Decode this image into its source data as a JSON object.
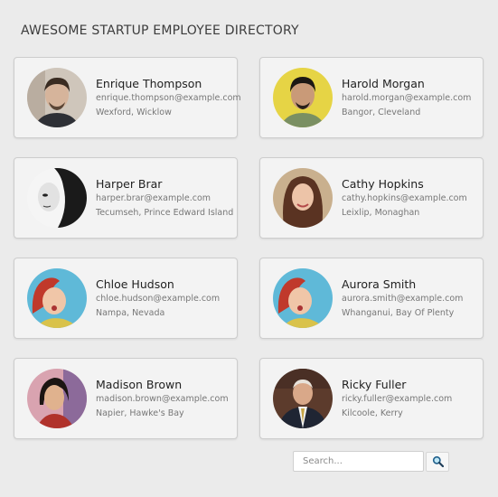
{
  "header": {
    "title": "AWESOME STARTUP EMPLOYEE DIRECTORY"
  },
  "employees": [
    {
      "name": "Enrique Thompson",
      "email": "enrique.thompson@example.com",
      "location": "Wexford, Wicklow",
      "avatar": "avatar-photo"
    },
    {
      "name": "Harold Morgan",
      "email": "harold.morgan@example.com",
      "location": "Bangor, Cleveland",
      "avatar": "avatar-photo"
    },
    {
      "name": "Harper Brar",
      "email": "harper.brar@example.com",
      "location": "Tecumseh, Prince Edward Island",
      "avatar": "avatar-photo"
    },
    {
      "name": "Cathy Hopkins",
      "email": "cathy.hopkins@example.com",
      "location": "Leixlip, Monaghan",
      "avatar": "avatar-photo"
    },
    {
      "name": "Chloe Hudson",
      "email": "chloe.hudson@example.com",
      "location": "Nampa, Nevada",
      "avatar": "avatar-photo"
    },
    {
      "name": "Aurora Smith",
      "email": "aurora.smith@example.com",
      "location": "Whanganui, Bay Of Plenty",
      "avatar": "avatar-photo"
    },
    {
      "name": "Madison Brown",
      "email": "madison.brown@example.com",
      "location": "Napier, Hawke's Bay",
      "avatar": "avatar-photo"
    },
    {
      "name": "Ricky Fuller",
      "email": "ricky.fuller@example.com",
      "location": "Kilcoole, Kerry",
      "avatar": "avatar-photo"
    }
  ],
  "search": {
    "placeholder": "Search...",
    "button_icon": "search-icon"
  }
}
